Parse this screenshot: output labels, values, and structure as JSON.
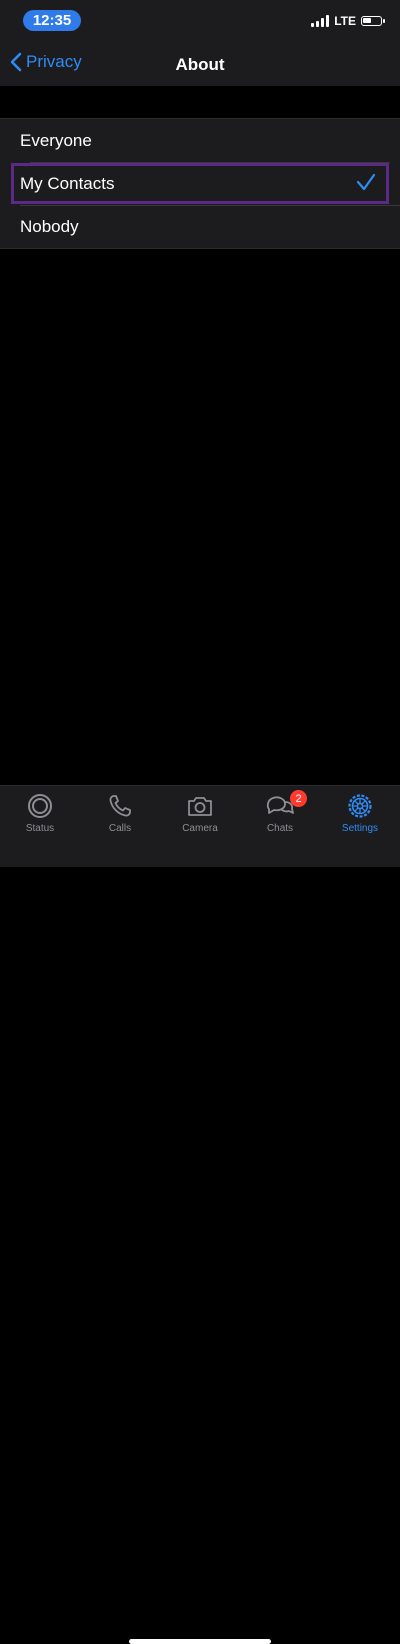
{
  "status_bar": {
    "time": "12:35",
    "network": "LTE",
    "battery_level": 0.5
  },
  "nav": {
    "back_label": "Privacy",
    "title": "About"
  },
  "options": [
    {
      "label": "Everyone",
      "selected": false
    },
    {
      "label": "My Contacts",
      "selected": true
    },
    {
      "label": "Nobody",
      "selected": false
    }
  ],
  "tab_bar": {
    "tabs": [
      {
        "label": "Status",
        "icon": "status-ring-icon",
        "active": false
      },
      {
        "label": "Calls",
        "icon": "phone-icon",
        "active": false
      },
      {
        "label": "Camera",
        "icon": "camera-icon",
        "active": false
      },
      {
        "label": "Chats",
        "icon": "chat-bubbles-icon",
        "active": false,
        "badge": "2"
      },
      {
        "label": "Settings",
        "icon": "gear-icon",
        "active": true
      }
    ]
  },
  "colors": {
    "accent": "#2f8bf5",
    "highlight_outline": "#5b2a86",
    "badge": "#ff3b30"
  }
}
